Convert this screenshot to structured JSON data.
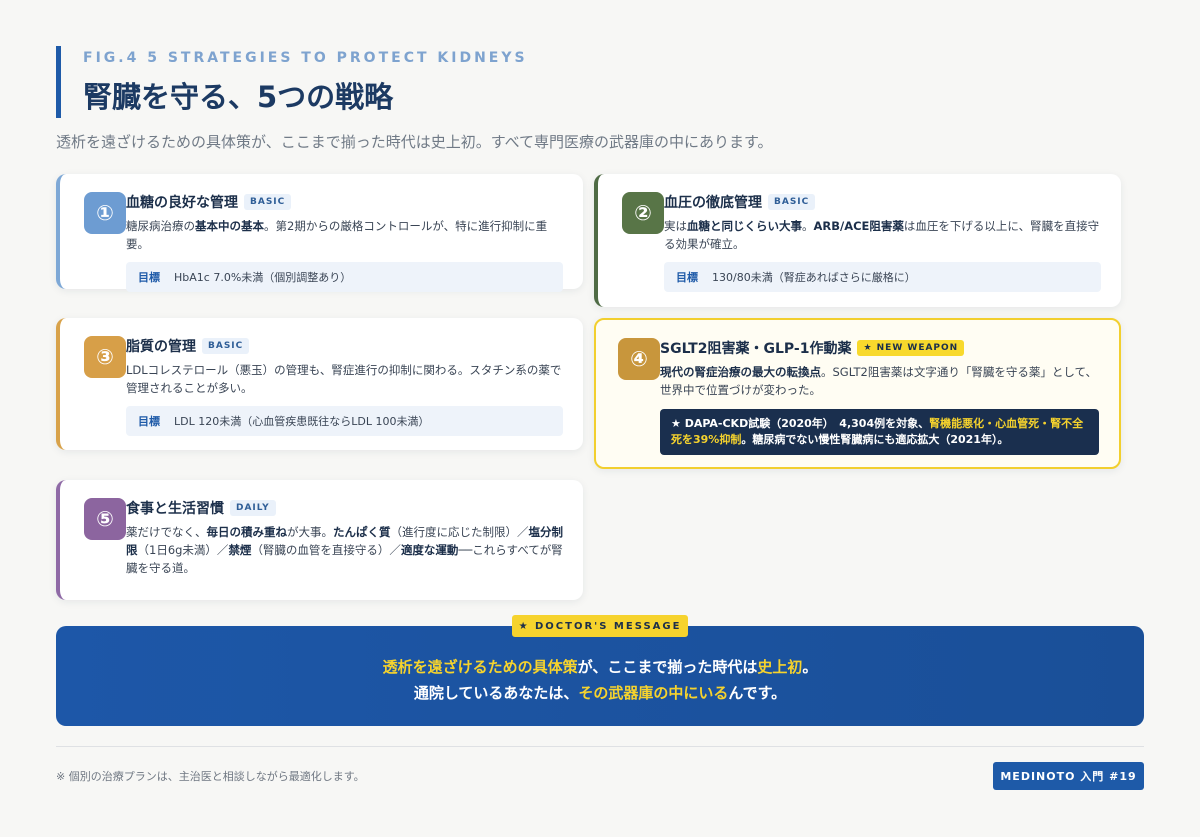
{
  "header": {
    "eyebrow": "FIG.4 5 STRATEGIES TO PROTECT KIDNEYS",
    "title": "腎臓を守る、5つの戦略",
    "subtitle": "透析を遠ざけるための具体策が、ここまで揃った時代は史上初。すべて専門医療の武器庫の中にあります。"
  },
  "cards": [
    {
      "num": "①",
      "title": "血糖の良好な管理",
      "tag": "BASIC",
      "desc_parts": [
        "糖尿病治療の",
        "基本中の基本",
        "。第2期からの厳格コントロールが、特に進行抑制に重要。"
      ],
      "goal_label": "目標",
      "goal_value": "HbA1c 7.0%未満（個別調整あり）"
    },
    {
      "num": "②",
      "title": "血圧の徹底管理",
      "tag": "BASIC",
      "desc_parts": [
        "実は",
        "血糖と同じくらい大事",
        "。",
        "ARB/ACE阻害薬",
        "は血圧を下げる以上に、腎臓を直接守る効果が確立。"
      ],
      "goal_label": "目標",
      "goal_value": "130/80未満（腎症あればさらに厳格に）"
    },
    {
      "num": "③",
      "title": "脂質の管理",
      "tag": "BASIC",
      "desc": "LDLコレステロール（悪玉）の管理も、腎症進行の抑制に関わる。スタチン系の薬で管理されることが多い。",
      "goal_label": "目標",
      "goal_value": "LDL 120未満（心血管疾患既往ならLDL 100未満）"
    },
    {
      "num": "④",
      "title": "SGLT2阻害薬・GLP-1作動薬",
      "tag": "★ NEW WEAPON",
      "desc_parts": [
        "現代の腎症治療の最大の転換点",
        "。SGLT2阻害薬は文字通り「腎臓を守る薬」として、世界中で位置づけが変わった。"
      ],
      "callout_parts": [
        "★ DAPA-CKD試験（2020年）　4,304例を対象、",
        "腎機能悪化・心血管死・腎不全死を39%抑制",
        "。糖尿病でない慢性腎臓病にも適応拡大（2021年）。"
      ]
    },
    {
      "num": "⑤",
      "title": "食事と生活習慣",
      "tag": "DAILY",
      "desc_parts": [
        "薬だけでなく、",
        "毎日の積み重ね",
        "が大事。",
        "たんぱく質",
        "（進行度に応じた制限）／",
        "塩分制限",
        "（1日6g未満）／",
        "禁煙",
        "（腎臓の血管を直接守る）／",
        "適度な運動",
        "──これらすべてが腎臓を守る道。"
      ]
    }
  ],
  "message": {
    "tag": "★ DOCTOR'S MESSAGE",
    "line1_parts": [
      "透析を遠ざけるための具体策",
      "が、ここまで揃った時代は",
      "史上初",
      "。"
    ],
    "line2_parts": [
      "通院しているあなたは、",
      "その武器庫の中にいる",
      "んです。"
    ]
  },
  "footer": {
    "note": "※ 個別の治療プランは、主治医と相談しながら最適化します。",
    "badge": "MEDINOTO 入門 #19"
  },
  "colors": {
    "accent": "#1e5aa8",
    "highlight": "#f6d32d",
    "card1": "#6d9cd2",
    "card2": "#587547",
    "card3": "#d79f48",
    "card4": "#c8963c",
    "card5": "#8c659f"
  }
}
